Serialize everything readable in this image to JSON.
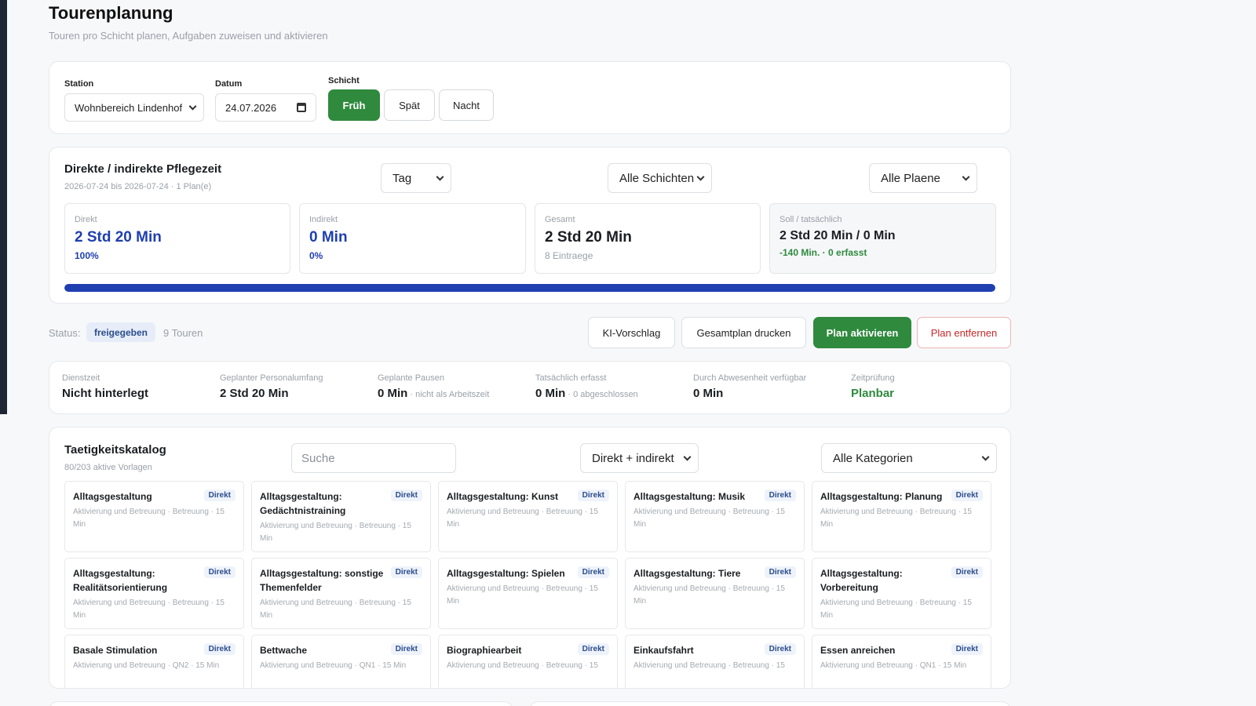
{
  "header": {
    "title": "Tourenplanung",
    "subtitle": "Touren pro Schicht planen, Aufgaben zuweisen und aktivieren"
  },
  "filters": {
    "station_label": "Station",
    "station_value": "Wohnbereich Lindenhof",
    "date_label": "Datum",
    "date_value": "24.07.2026",
    "shift_label": "Schicht",
    "shifts": [
      "Früh",
      "Spät",
      "Nacht"
    ],
    "active_shift": "Früh"
  },
  "care_time": {
    "title": "Direkte / indirekte Pflegezeit",
    "subtitle": "2026-07-24 bis 2026-07-24 · 1 Plan(e)",
    "period_select": "Tag",
    "shift_select": "Alle Schichten",
    "plan_select": "Alle Plaene",
    "stats": [
      {
        "label": "Direkt",
        "value": "2 Std 20 Min",
        "foot": "100%"
      },
      {
        "label": "Indirekt",
        "value": "0 Min",
        "foot": "0%"
      },
      {
        "label": "Gesamt",
        "value": "2 Std 20 Min",
        "foot": "8 Eintraege"
      },
      {
        "label": "Soll / tatsächlich",
        "value": "2 Std 20 Min / 0 Min",
        "foot": "-140 Min. · 0 erfasst"
      }
    ],
    "direct_share_percent": 100
  },
  "status": {
    "label": "Status:",
    "badge": "freigegeben",
    "tours": "9 Touren",
    "buttons": {
      "ai": "KI-Vorschlag",
      "print": "Gesamtplan drucken",
      "activate": "Plan aktivieren",
      "remove": "Plan entfernen"
    }
  },
  "info": [
    {
      "label": "Dienstzeit",
      "value": "Nicht hinterlegt",
      "note": ""
    },
    {
      "label": "Geplanter Personalumfang",
      "value": "2 Std 20 Min",
      "note": ""
    },
    {
      "label": "Geplante Pausen",
      "value": "0 Min",
      "note": " · nicht als Arbeitszeit"
    },
    {
      "label": "Tatsächlich erfasst",
      "value": "0 Min",
      "note": " · 0 abgeschlossen"
    },
    {
      "label": "Durch Abwesenheit verfügbar",
      "value": "0 Min",
      "note": ""
    },
    {
      "label": "Zeitprüfung",
      "value": "Planbar",
      "note": ""
    }
  ],
  "catalog": {
    "title": "Taetigkeitskatalog",
    "subtitle": "80/203 aktive Vorlagen",
    "search_placeholder": "Suche",
    "type_select": "Direkt + indirekt",
    "category_select": "Alle Kategorien",
    "items": [
      {
        "name": "Alltagsgestaltung",
        "badge": "Direkt",
        "meta": "Aktivierung und Betreuung · Betreuung · 15 Min"
      },
      {
        "name": "Alltagsgestaltung: Gedächtnistraining",
        "badge": "Direkt",
        "meta": "Aktivierung und Betreuung · Betreuung · 15 Min"
      },
      {
        "name": "Alltagsgestaltung: Kunst",
        "badge": "Direkt",
        "meta": "Aktivierung und Betreuung · Betreuung · 15 Min"
      },
      {
        "name": "Alltagsgestaltung: Musik",
        "badge": "Direkt",
        "meta": "Aktivierung und Betreuung · Betreuung · 15 Min"
      },
      {
        "name": "Alltagsgestaltung: Planung",
        "badge": "Direkt",
        "meta": "Aktivierung und Betreuung · Betreuung · 15 Min"
      },
      {
        "name": "Alltagsgestaltung: Realitätsorientierung",
        "badge": "Direkt",
        "meta": "Aktivierung und Betreuung · Betreuung · 15 Min"
      },
      {
        "name": "Alltagsgestaltung: sonstige Themenfelder",
        "badge": "Direkt",
        "meta": "Aktivierung und Betreuung · Betreuung · 15 Min"
      },
      {
        "name": "Alltagsgestaltung: Spielen",
        "badge": "Direkt",
        "meta": "Aktivierung und Betreuung · Betreuung · 15 Min"
      },
      {
        "name": "Alltagsgestaltung: Tiere",
        "badge": "Direkt",
        "meta": "Aktivierung und Betreuung · Betreuung · 15 Min"
      },
      {
        "name": "Alltagsgestaltung: Vorbereitung",
        "badge": "Direkt",
        "meta": "Aktivierung und Betreuung · Betreuung · 15 Min"
      },
      {
        "name": "Basale Stimulation",
        "badge": "Direkt",
        "meta": "Aktivierung und Betreuung · QN2 · 15 Min"
      },
      {
        "name": "Bettwache",
        "badge": "Direkt",
        "meta": "Aktivierung und Betreuung · QN1 · 15 Min"
      },
      {
        "name": "Biographiearbeit",
        "badge": "Direkt",
        "meta": "Aktivierung und Betreuung · Betreuung · 15"
      },
      {
        "name": "Einkaufsfahrt",
        "badge": "Direkt",
        "meta": "Aktivierung und Betreuung · Betreuung · 15"
      },
      {
        "name": "Essen anreichen",
        "badge": "Direkt",
        "meta": "Aktivierung und Betreuung · QN1 · 15 Min"
      }
    ]
  },
  "colors": {
    "accent_green": "#2f8a3e",
    "accent_blue": "#1f3fb0",
    "danger": "#c62828"
  }
}
